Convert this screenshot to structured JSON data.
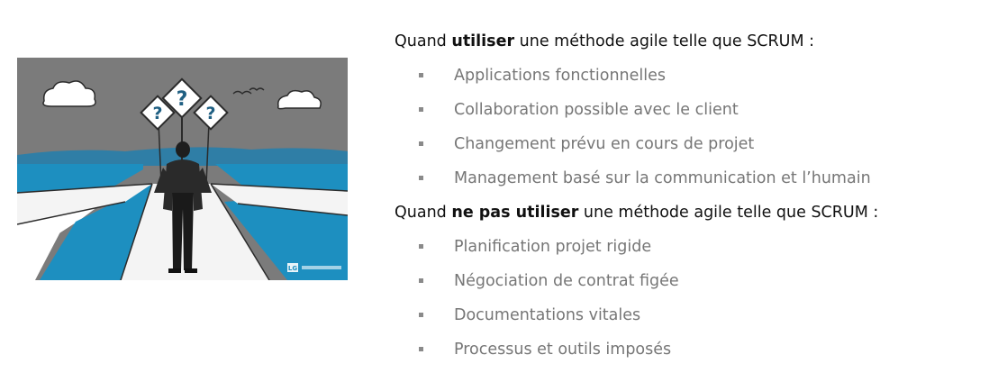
{
  "illustration": {
    "question_mark": "?",
    "watermark_text": "LG"
  },
  "section_use": {
    "prefix": "Quand ",
    "emphasis": "utiliser",
    "suffix": " une méthode agile telle que SCRUM :",
    "items": [
      "Applications fonctionnelles",
      "Collaboration possible avec le client",
      "Changement prévu en cours de projet",
      "Management basé sur la communication et l’humain"
    ]
  },
  "section_not_use": {
    "prefix": "Quand ",
    "emphasis": "ne pas utiliser",
    "suffix": " une méthode agile telle que SCRUM :",
    "items": [
      "Planification projet rigide",
      "Négociation de contrat figée",
      "Documentations vitales",
      "Processus et outils imposés"
    ]
  }
}
